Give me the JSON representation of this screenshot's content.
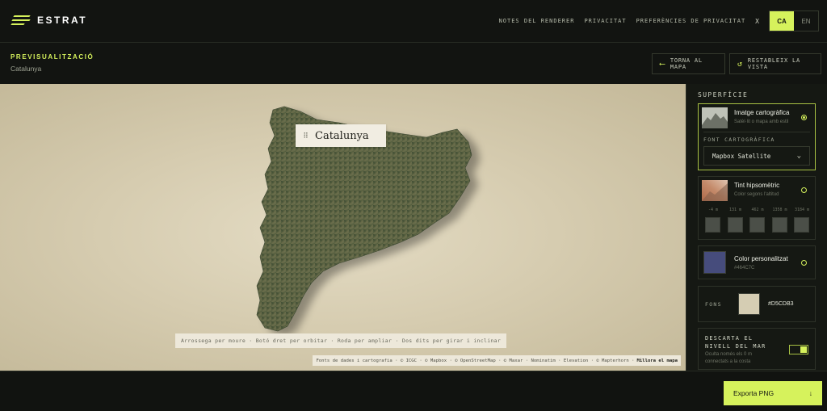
{
  "brand": {
    "name": "ESTRAT",
    "accent": "#d6f25c"
  },
  "nav": {
    "renderer_notes": "NOTES DEL RENDERER",
    "privacy": "PRIVACITAT",
    "privacy_prefs": "PREFERÈNCIES DE PRIVACITAT",
    "close": "X",
    "lang_active": "CA",
    "lang_other": "EN"
  },
  "preview": {
    "title": "PREVISUALITZACIÓ",
    "region": "Catalunya",
    "back_button": "TORNA AL MAPA",
    "reset_button": "RESTABLEIX LA VISTA"
  },
  "map": {
    "label": "Catalunya",
    "hint": "Arrossega per moure · Botó dret per orbitar · Roda per ampliar · Dos dits per girar i inclinar",
    "attribution": "Fonts de dades i cartografia · © ICGC · © Mapbox · © OpenStreetMap · © Maxar · Nominatim · Elevation · © Mapterhorn ·",
    "improve_link": "Millora el mapa"
  },
  "panel": {
    "title": "SUPERFÍCIE",
    "imagery": {
      "name": "Imatge cartogràfica",
      "desc": "Satèl·lit o mapa amb estil",
      "source_label": "FONT CARTOGRÀFICA",
      "source_value": "Mapbox Satellite",
      "selected": true
    },
    "hypso": {
      "name": "Tint hipsomètric",
      "desc": "Color segons l'altitud",
      "stops": [
        "-4 m",
        "131 m",
        "462 m",
        "1358 m",
        "3184 m"
      ]
    },
    "custom": {
      "name": "Color personalitzat",
      "hex": "#464C7C",
      "color": "#464c7c"
    },
    "background": {
      "label": "FONS",
      "hex": "#D5CDB3",
      "color": "#d5cdb3"
    },
    "sea": {
      "title": "DESCARTA EL NIVELL DEL MAR",
      "desc": "Oculta només els 0 m connectats a la costa",
      "enabled": true
    }
  },
  "export": {
    "label": "Exporta PNG",
    "icon": "arrow-down-icon"
  }
}
